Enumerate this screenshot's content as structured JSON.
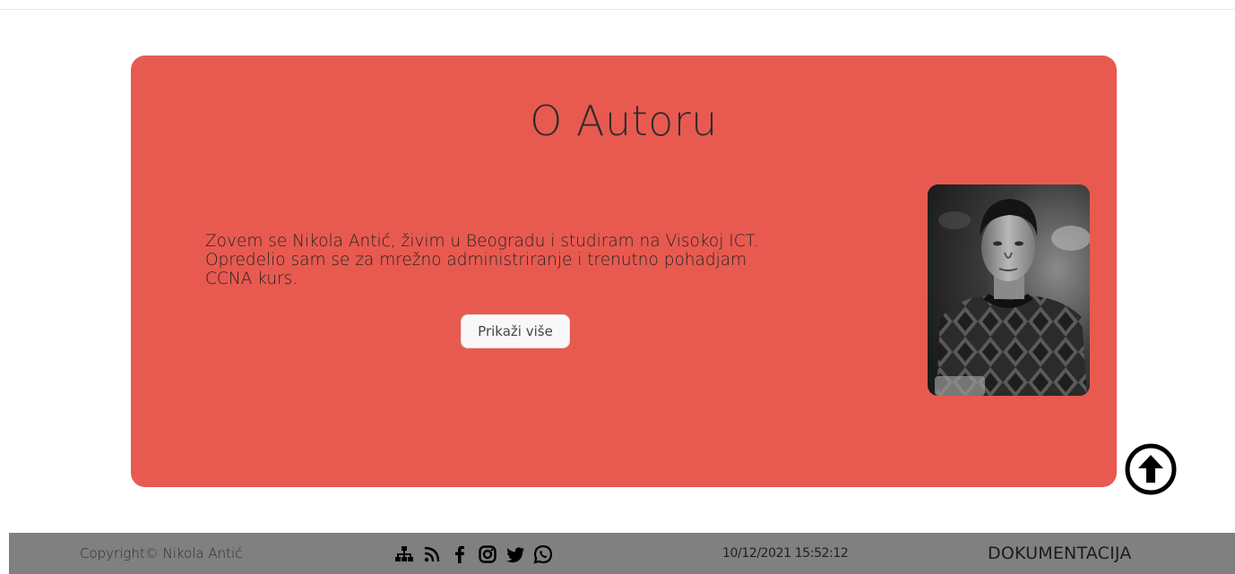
{
  "about": {
    "title": "O Autoru",
    "text": "Zovem se Nikola Antić, živim u Beogradu i studiram na Visokoj ICT. Opredelio sam se za mrežno administriranje i trenutno pohadjam CCNA kurs.",
    "button_label": "Prikaži više",
    "photo_icon": "author-portrait"
  },
  "scroll_top": {
    "icon": "arrow-up-circle-icon"
  },
  "footer": {
    "copyright": "Copyright© Nikola Antić",
    "social_icons": [
      "sitemap-icon",
      "rss-icon",
      "facebook-icon",
      "instagram-icon",
      "twitter-icon",
      "whatsapp-icon"
    ],
    "datetime": "10/12/2021 15:52:12",
    "docs_label": "DOKUMENTACIJA"
  },
  "colors": {
    "card_background": "#e85a50",
    "footer_background": "#808080"
  }
}
